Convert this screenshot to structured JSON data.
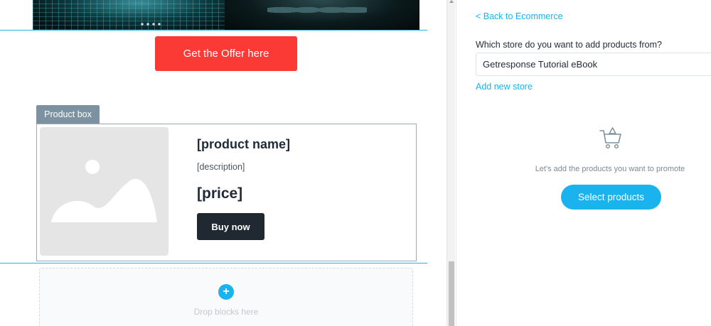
{
  "canvas": {
    "hero_image": {
      "icon": "hero-banner-image"
    },
    "cta_button_label": "Get the Offer here",
    "product_box": {
      "tag_label": "Product box",
      "image_icon": "image-placeholder-icon",
      "name": "[product name]",
      "description": "[description]",
      "price": "[price]",
      "buy_label": "Buy now"
    },
    "drop_zone": {
      "add_icon": "+",
      "label": "Drop blocks here"
    }
  },
  "panel": {
    "back_link": "< Back to Ecommerce",
    "store_question": "Which store do you want to add products from?",
    "store_selected": "Getresponse Tutorial eBook",
    "add_store_link": "Add new store",
    "empty_icon": "shopping-cart-icon",
    "empty_message": "Let's add the products you want to promote",
    "select_products_label": "Select products"
  },
  "colors": {
    "accent": "#1ab3ee",
    "cta": "#fb3a35",
    "tag": "#7d92a1",
    "buy": "#202932",
    "guide": "#29b6e6"
  }
}
